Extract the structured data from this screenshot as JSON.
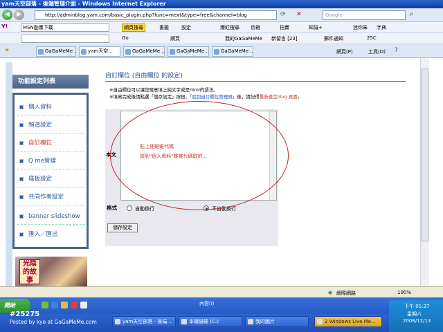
{
  "window": {
    "title": "yam天空部落 - 後端管理介面 - Windows Internet Explorer"
  },
  "address": {
    "url": "http://adminblog.yam.com/basic_plugin.php?func=mext&type=free&channel=blog",
    "search_placeholder": "Google"
  },
  "yahoo_toolbar": {
    "search_value": "MSN動畫下載",
    "search_button": "網頁搜尋",
    "items": [
      "書籤",
      "設定",
      "爆紅搜尋",
      "信箱",
      "拍賣",
      "知識+",
      "迷你笨",
      "字典"
    ]
  },
  "toolbar2": {
    "go_label": "Go",
    "link1": "網頁",
    "my_gagameme": "我的GaGaMeMe",
    "new_msgs": "新留言 [23]",
    "mail_notify": "郵件通知",
    "weather": "25C"
  },
  "tabs": [
    "GaGaMeMe ...",
    "yam天空...",
    "GaGaMeMe ...",
    "GaGaMeMe ...",
    "GaGaMeMe ..."
  ],
  "tab_tools": {
    "page": "網頁(P)",
    "tools": "工具(O)"
  },
  "sidebar": {
    "title": "功能設定列表",
    "items": [
      "個人資料",
      "頻道設定",
      "自訂欄位",
      "Q me管理",
      "樣板設定",
      "共同作者設定",
      "banner slideshow",
      "匯入／匯出"
    ],
    "current_index": 2,
    "thumb_text": "光陰的故事"
  },
  "main": {
    "title": "自訂欄位 (自由欄位 的設定)",
    "note1": "※自由欄位可以讓您隨意填上純文字或是html的語法。",
    "note2_a": "※填寫完成後請點選「儲存設定」按鈕，",
    "note2_link": "「回到自訂欄位管理頁」",
    "note2_b": "後，請記得",
    "note2_red": "重新產生blog 頁面",
    "note2_c": "。",
    "label_body": "本文",
    "textarea_line1": "貼上插雉雉代碼",
    "textarea_line2": "請到\"個人資料\"雉雉代碼取的...",
    "label_format": "格式",
    "radio1": "自動換行",
    "radio2": "不自動換行",
    "save_button": "儲存設定"
  },
  "status": {
    "zone": "網際網路",
    "zoom": "100%"
  },
  "taskbar": {
    "start": "開始",
    "tasks": [
      "yam天空部落 - 後端...",
      "本機磁碟 (C:)",
      "我的圖片",
      "2 Windows Live Me..."
    ],
    "input_method": "內容(I)",
    "time": "下午 01:37",
    "weekday": "星期六",
    "date": "2008/12/13"
  },
  "watermark": {
    "line1": "#25275",
    "line2": "Posted by kyo at GaGaMeMe.com"
  }
}
